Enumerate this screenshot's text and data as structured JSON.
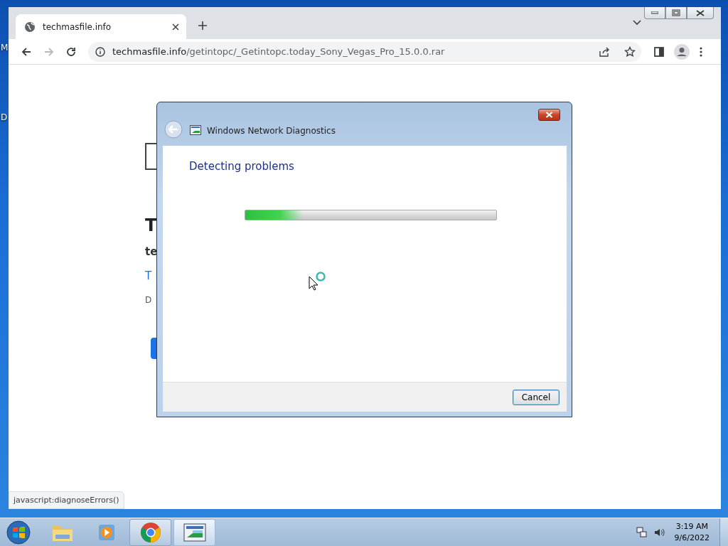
{
  "desktop": {
    "labels": [
      "M",
      "D"
    ]
  },
  "browser": {
    "tabs": [
      {
        "title": "techmasfile.info",
        "selected": true
      }
    ],
    "nav": [
      {
        "kind": "back",
        "disabled": false
      },
      {
        "kind": "forward",
        "disabled": true
      },
      {
        "kind": "reload",
        "disabled": false
      }
    ],
    "address": {
      "host": "techmasfile.info",
      "path": "/getintopc/_Getintopc.today_Sony_Vegas_Pro_15.0.0.rar"
    },
    "page_fragments": [
      {
        "kind": "heading",
        "text": "T"
      },
      {
        "kind": "bold",
        "text": "te"
      },
      {
        "kind": "link",
        "text": "T"
      },
      {
        "kind": "body",
        "text": "D"
      }
    ],
    "status_url": "javascript:diagnoseErrors()"
  },
  "dialog": {
    "title": "Windows Network Diagnostics",
    "heading": "Detecting problems",
    "progress": {
      "level": 0.23
    },
    "buttons": [
      "Cancel"
    ]
  },
  "taskbar": {
    "items": [
      {
        "kind": "explorer",
        "open": false,
        "selected": false
      },
      {
        "kind": "media",
        "open": false,
        "selected": false
      },
      {
        "kind": "chrome",
        "open": true,
        "selected": false
      },
      {
        "kind": "diagnostics",
        "open": true,
        "selected": true
      }
    ],
    "clock": {
      "time": "3:19 AM",
      "date": "9/6/2022"
    }
  }
}
